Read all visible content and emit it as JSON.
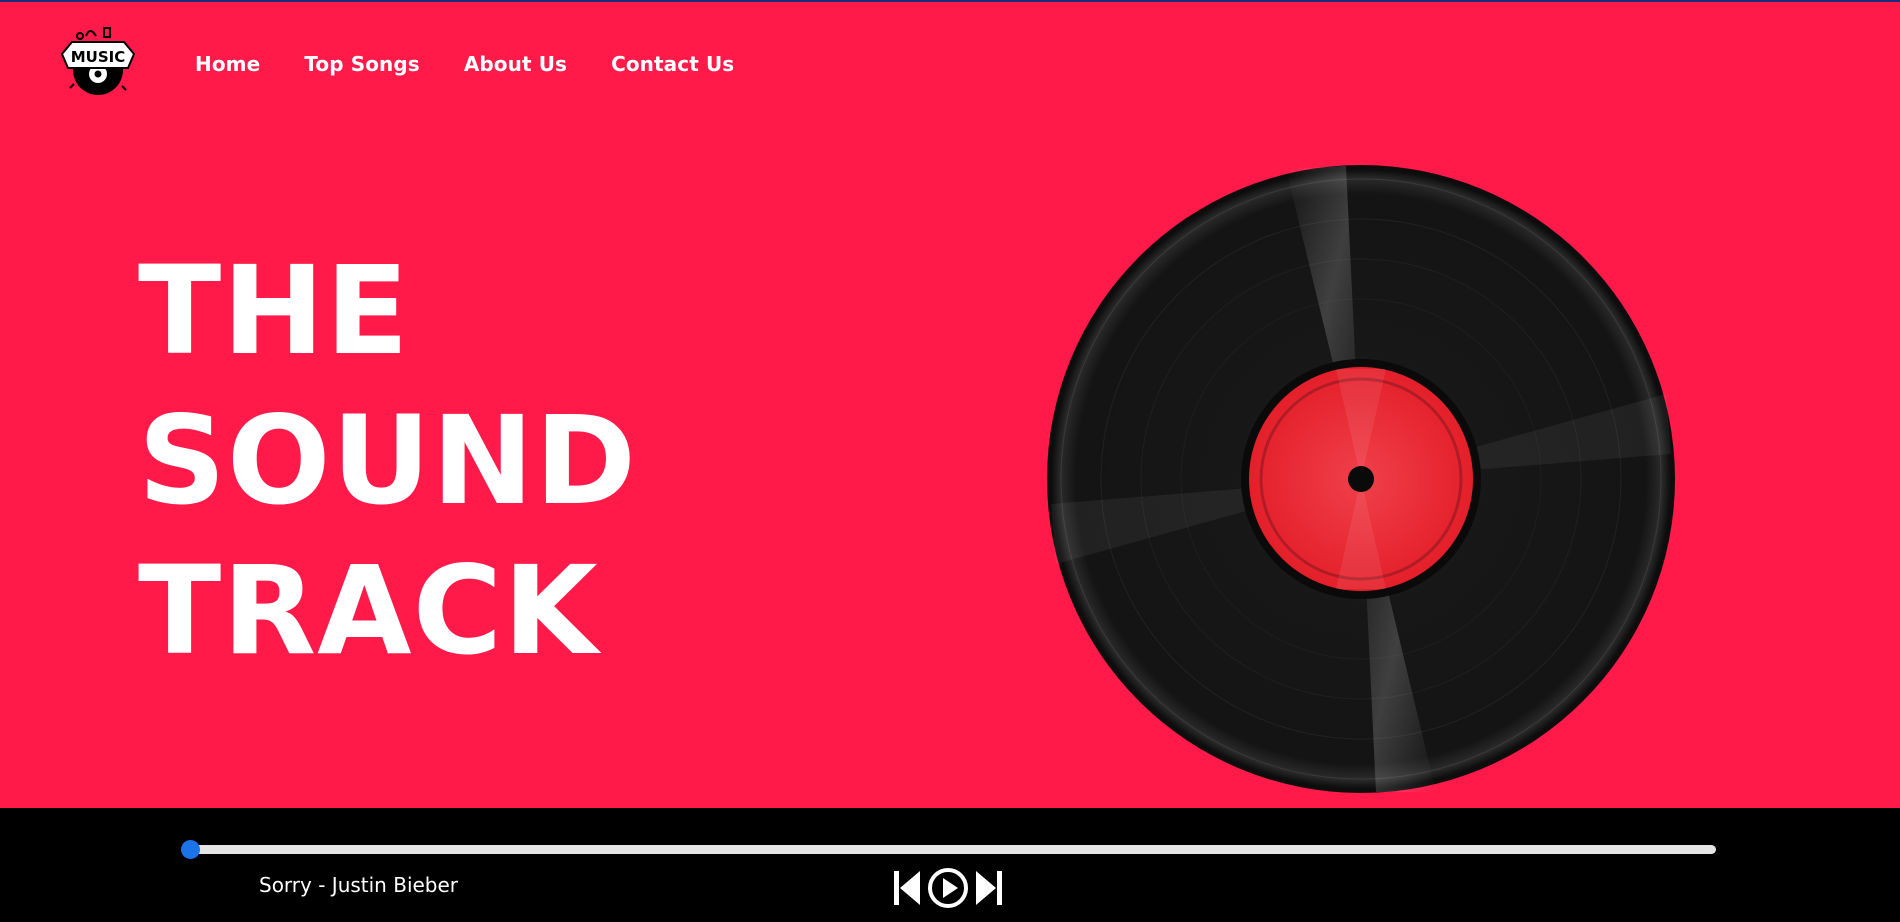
{
  "brand": {
    "logo_text": "MUSIC"
  },
  "nav": {
    "items": [
      {
        "label": "Home"
      },
      {
        "label": "Top Songs"
      },
      {
        "label": "About Us"
      },
      {
        "label": "Contact Us"
      }
    ]
  },
  "hero": {
    "lines": [
      "THE",
      "SOUND",
      "TRACK"
    ]
  },
  "player": {
    "song_title": "Sorry - Justin Bieber",
    "progress": 0.0,
    "controls": [
      "previous-icon",
      "play-icon",
      "next-icon"
    ]
  },
  "colors": {
    "hero_bg": "#ff1a4a",
    "player_bg": "#000000",
    "accent": "#1a73e8",
    "label_red": "#e8202c"
  }
}
